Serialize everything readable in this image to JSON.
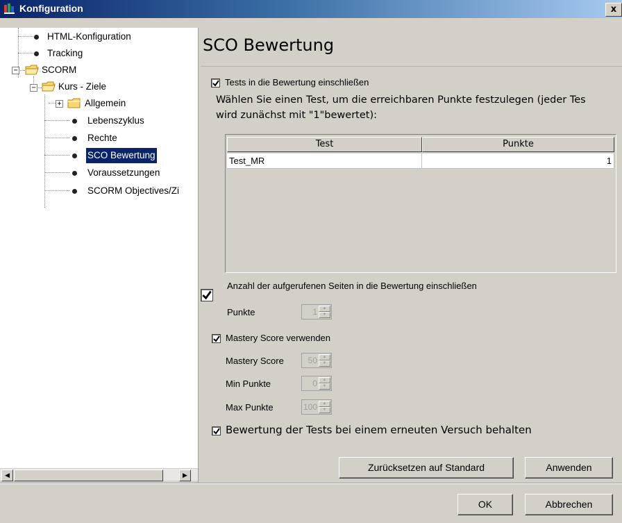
{
  "window": {
    "title": "Konfiguration",
    "close_glyph": "x",
    "accent_color": "#0a246a"
  },
  "tree": {
    "items": [
      {
        "label": "HTML-Konfiguration",
        "icon": "bullet-icon"
      },
      {
        "label": "Tracking",
        "icon": "bullet-icon"
      },
      {
        "label": "SCORM",
        "icon": "folder-icon",
        "expander": "−"
      },
      {
        "label": "Kurs - Ziele",
        "icon": "folder-icon",
        "expander": "−"
      },
      {
        "label": "Allgemein",
        "icon": "folder-icon",
        "expander": "+"
      },
      {
        "label": "Lebenszyklus",
        "icon": "bullet-icon"
      },
      {
        "label": "Rechte",
        "icon": "bullet-icon"
      },
      {
        "label": "SCO Bewertung",
        "icon": "bullet-icon",
        "selected": true
      },
      {
        "label": "Voraussetzungen",
        "icon": "bullet-icon"
      },
      {
        "label": "SCORM Objectives/Zi",
        "icon": "bullet-icon"
      }
    ],
    "scroll_left": "◀",
    "scroll_right": "▶"
  },
  "panel": {
    "title": "SCO Bewertung",
    "include_tests": {
      "label": "Tests in die Bewertung einschließen",
      "checked": true,
      "description_line1": "Wählen Sie einen Test, um die erreichbaren Punkte festzulegen (jeder Tes",
      "description_line2": "wird zunächst mit \"1\"bewertet):"
    },
    "table": {
      "columns": [
        "Test",
        "Punkte"
      ],
      "rows": [
        {
          "test": "Test_MR",
          "punkte": "1"
        }
      ]
    },
    "pages": {
      "label": "Anzahl der aufgerufenen Seiten in die Bewertung einschließen",
      "checked": true,
      "points_label": "Punkte",
      "points_value": "1"
    },
    "mastery": {
      "label": "Mastery Score verwenden",
      "checked": true,
      "score_label": "Mastery Score",
      "score_value": "50",
      "min_label": "Min Punkte",
      "min_value": "0",
      "max_label": "Max Punkte",
      "max_value": "100"
    },
    "keep_scores": {
      "label": "Bewertung der Tests bei einem erneuten Versuch behalten",
      "checked": true
    },
    "reset_button": "Zurücksetzen auf Standard",
    "apply_button": "Anwenden"
  },
  "footer": {
    "ok_button": "OK",
    "cancel_button": "Abbrechen"
  }
}
